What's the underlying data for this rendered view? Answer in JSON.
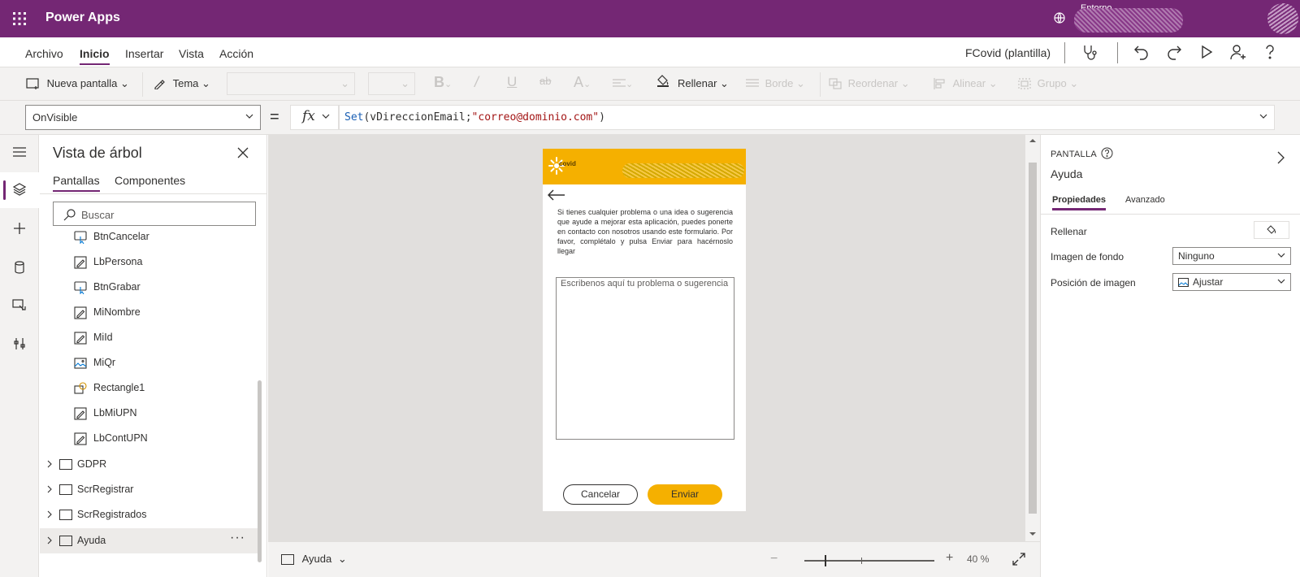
{
  "app": {
    "brand": "Power Apps",
    "environment_label": "Entorno"
  },
  "menu": {
    "tabs": [
      "Archivo",
      "Inicio",
      "Insertar",
      "Vista",
      "Acción"
    ],
    "active_tab": "Inicio",
    "app_name": "FCovid (plantilla)"
  },
  "ribbon": {
    "new_screen": "Nueva pantalla",
    "theme": "Tema",
    "fill": "Rellenar",
    "border": "Borde",
    "reorder": "Reordenar",
    "align": "Alinear",
    "group": "Grupo"
  },
  "formula": {
    "property": "OnVisible",
    "fx": "fx",
    "expr_func": "Set",
    "expr_args_prefix": "(vDireccionEmail;",
    "expr_string": "\"correo@dominio.com\"",
    "expr_suffix": ")"
  },
  "tree": {
    "title": "Vista de árbol",
    "tabs": [
      "Pantallas",
      "Componentes"
    ],
    "search_placeholder": "Buscar",
    "nodes": [
      {
        "label": "BtnCancelar",
        "icon": "button-icon"
      },
      {
        "label": "LbPersona",
        "icon": "label-icon"
      },
      {
        "label": "BtnGrabar",
        "icon": "button-icon"
      },
      {
        "label": "MiNombre",
        "icon": "label-icon"
      },
      {
        "label": "MiId",
        "icon": "label-icon"
      },
      {
        "label": "MiQr",
        "icon": "image-icon"
      },
      {
        "label": "Rectangle1",
        "icon": "shape-icon"
      },
      {
        "label": "LbMiUPN",
        "icon": "label-icon"
      },
      {
        "label": "LbContUPN",
        "icon": "label-icon"
      }
    ],
    "screens": [
      {
        "label": "GDPR"
      },
      {
        "label": "ScrRegistrar"
      },
      {
        "label": "ScrRegistrados"
      },
      {
        "label": "Ayuda"
      }
    ],
    "more": "···"
  },
  "appscreen": {
    "logo_text": "covid",
    "text": "Si tienes cualquier problema o una idea o sugerencia que ayude a mejorar esta aplicación, puedes ponerte en contacto con nosotros usando este formulario. Por favor, complétalo y pulsa Enviar para hacérnoslo llegar",
    "textarea_placeholder": "Escribenos aquí tu problema o sugerencia",
    "cancel": "Cancelar",
    "send": "Enviar",
    "colors": {
      "header": "#f5b000",
      "send_button": "#f5b000"
    }
  },
  "canvas_bar": {
    "screen": "Ayuda",
    "zoom": "40",
    "zoom_unit": "%"
  },
  "props": {
    "type": "PANTALLA",
    "name": "Ayuda",
    "tabs": [
      "Propiedades",
      "Avanzado"
    ],
    "fill_label": "Rellenar",
    "bg_image_label": "Imagen de fondo",
    "bg_image_value": "Ninguno",
    "img_position_label": "Posición de imagen",
    "img_position_value": "Ajustar"
  },
  "colors": {
    "brand": "#742774",
    "accent_yellow": "#f5b000"
  }
}
